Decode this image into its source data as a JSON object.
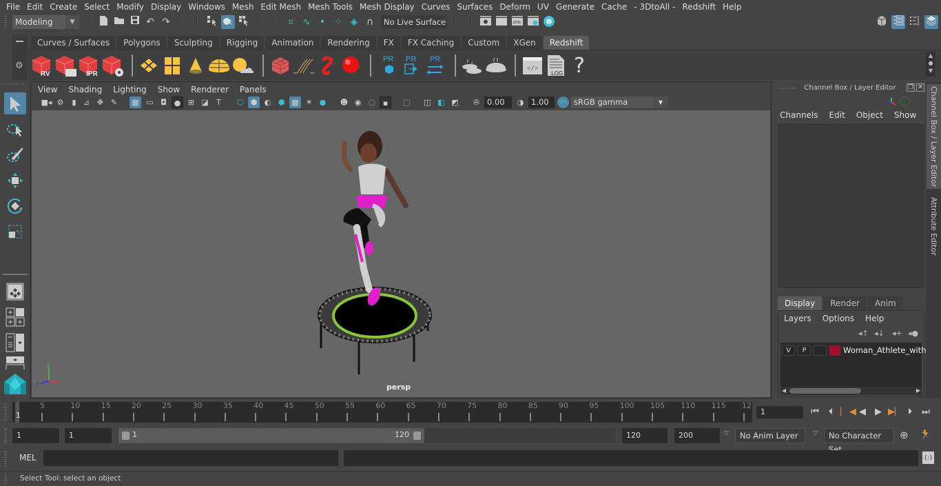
{
  "menubar": {
    "items": [
      "File",
      "Edit",
      "Create",
      "Select",
      "Modify",
      "Display",
      "Windows",
      "Mesh",
      "Edit Mesh",
      "Mesh Tools",
      "Mesh Display",
      "Curves",
      "Surfaces",
      "Deform",
      "UV",
      "Generate",
      "Cache",
      "- 3DtoAll -",
      "Redshift",
      "Help"
    ]
  },
  "statusline": {
    "mode": "Modeling",
    "live_surface": "No Live Surface",
    "icons": [
      "new-scene-icon",
      "open-scene-icon",
      "save-scene-icon",
      "undo-icon",
      "redo-icon",
      "select-by-hierarchy-icon",
      "select-by-object-icon",
      "select-by-component-icon",
      "snap-grid-icon",
      "snap-curve-icon",
      "snap-point-icon",
      "snap-view-plane-icon",
      "snap-live-icon",
      "make-live-icon",
      "render-view-icon",
      "render-frame-icon",
      "ipr-render-icon",
      "render-settings-icon",
      "hypershade-icon"
    ],
    "right_icons": [
      "modeling-toolkit-icon",
      "attribute-editor-icon",
      "tool-settings-icon",
      "channel-box-icon"
    ]
  },
  "shelf": {
    "tabs": [
      "Curves / Surfaces",
      "Polygons",
      "Sculpting",
      "Rigging",
      "Animation",
      "Rendering",
      "FX",
      "FX Caching",
      "Custom",
      "XGen",
      "Redshift"
    ],
    "active_tab": "Redshift",
    "items": [
      {
        "name": "rs-render-view",
        "label": "RV"
      },
      {
        "name": "rs-render-sequence",
        "label": ""
      },
      {
        "name": "rs-ipr",
        "label": "IPR"
      },
      {
        "name": "rs-render-settings",
        "label": ""
      },
      {
        "name": "rs-area-light",
        "label": ""
      },
      {
        "name": "rs-portal-light",
        "label": ""
      },
      {
        "name": "rs-physical-light",
        "label": ""
      },
      {
        "name": "rs-dome-light",
        "label": ""
      },
      {
        "name": "rs-sun-sky",
        "label": ""
      },
      {
        "name": "rs-proxy",
        "label": ""
      },
      {
        "name": "rs-hair",
        "label": ""
      },
      {
        "name": "rs-volume",
        "label": ""
      },
      {
        "name": "rs-sphere",
        "label": ""
      },
      {
        "name": "rs-proxy-create",
        "label": "PR"
      },
      {
        "name": "rs-proxy-export",
        "label": "PR"
      },
      {
        "name": "rs-proxy-convert",
        "label": "PR"
      },
      {
        "name": "rs-bake-multiple",
        "label": ""
      },
      {
        "name": "rs-bake",
        "label": ""
      },
      {
        "name": "rs-script-editor",
        "label": ""
      },
      {
        "name": "rs-log",
        "label": ".LOG"
      },
      {
        "name": "rs-help",
        "label": "?"
      }
    ]
  },
  "toolbox": {
    "tools": [
      "select-tool",
      "lasso-tool",
      "paint-select-tool",
      "move-tool",
      "rotate-tool",
      "scale-tool"
    ],
    "layouts": [
      "single-perspective-layout",
      "four-view-layout",
      "outliner-persp-layout",
      "graph-persp-layout"
    ]
  },
  "viewport": {
    "menu": [
      "View",
      "Shading",
      "Lighting",
      "Show",
      "Renderer",
      "Panels"
    ],
    "exposure": "0.00",
    "gamma": "1.00",
    "color_mgmt": "ON",
    "colorspace": "sRGB gamma",
    "camera_label": "persp",
    "axis": {
      "x": "x",
      "y": "y",
      "z": "z"
    }
  },
  "channel_box": {
    "title": "Channel Box / Layer Editor",
    "menu": [
      "Channels",
      "Edit",
      "Object",
      "Show"
    ]
  },
  "layer_editor": {
    "tabs": [
      "Display",
      "Render",
      "Anim"
    ],
    "active_tab": "Display",
    "menu": [
      "Layers",
      "Options",
      "Help"
    ],
    "layers": [
      {
        "visible": "V",
        "playback": "P",
        "type": "",
        "color": "#a0102c",
        "name": "Woman_Athlete_with_"
      }
    ]
  },
  "side_tabs": [
    "Channel Box / Layer Editor",
    "Attribute Editor"
  ],
  "timeline": {
    "start_label": "1",
    "ticks": [
      "5",
      "10",
      "15",
      "20",
      "25",
      "30",
      "35",
      "40",
      "45",
      "50",
      "55",
      "60",
      "65",
      "70",
      "75",
      "80",
      "85",
      "90",
      "95",
      "100",
      "105",
      "110",
      "115",
      "12"
    ],
    "current_frame": "1"
  },
  "range": {
    "start": "1",
    "playback_start": "1",
    "slider_min": "1",
    "slider_max": "120",
    "playback_end": "120",
    "end": "200",
    "anim_layer": "No Anim Layer",
    "character_set": "No Character Set"
  },
  "command": {
    "language": "MEL",
    "input": "",
    "result": ""
  },
  "status": {
    "help_line": "Select Tool: select an object"
  },
  "colors": {
    "accent": "#5285a6",
    "panel": "#444444",
    "viewport_bg": "#666666",
    "field": "#2b2b2b",
    "redshift_red": "#e0403f",
    "teal": "#3ebfcf"
  }
}
